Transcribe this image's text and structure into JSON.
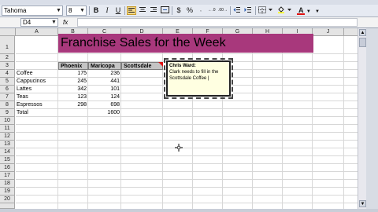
{
  "toolbar": {
    "font_name": "Tahoma",
    "font_size": "8",
    "bold": "B",
    "italic": "I",
    "underline": "U",
    "currency": "$",
    "percent": "%",
    "font_color_letter": "A"
  },
  "formula_bar": {
    "name_box": "D4",
    "fx": "fx",
    "value": ""
  },
  "sheet": {
    "columns": [
      "A",
      "B",
      "C",
      "D",
      "E",
      "F",
      "G",
      "H",
      "I",
      "J"
    ],
    "rows": [
      "1",
      "2",
      "3",
      "4",
      "5",
      "6",
      "7",
      "8",
      "9",
      "10",
      "11",
      "12",
      "13",
      "14",
      "15",
      "16",
      "17",
      "18",
      "19",
      "20"
    ],
    "title": "Franchise Sales for the Week",
    "headers": [
      "Phoenix",
      "Maricopa",
      "Scottsdale"
    ],
    "items": [
      {
        "label": "Coffee",
        "phoenix": "175",
        "maricopa": "236"
      },
      {
        "label": "Cappucinos",
        "phoenix": "245",
        "maricopa": "441"
      },
      {
        "label": "Lattes",
        "phoenix": "342",
        "maricopa": "101"
      },
      {
        "label": "Teas",
        "phoenix": "123",
        "maricopa": "124"
      },
      {
        "label": "Espressos",
        "phoenix": "298",
        "maricopa": "698"
      }
    ],
    "total_label": "Total",
    "total_maricopa": "1600"
  },
  "comment": {
    "author": "Chris Ward:",
    "text": "Clark needs to fill in the Scottsdale Coffee |"
  },
  "colors": {
    "title_fill": "#a8387c",
    "header_fill": "#c4c4c4",
    "comment_fill": "#ffffe1"
  }
}
